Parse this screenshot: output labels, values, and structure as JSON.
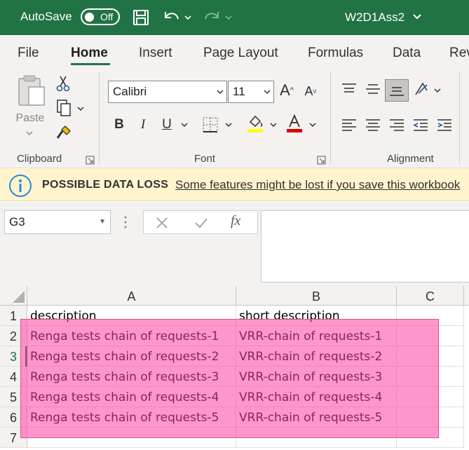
{
  "titlebar": {
    "autosave_label": "AutoSave",
    "autosave_state": "Off",
    "doc_title": "W2D1Ass2",
    "bg_color": "#217346"
  },
  "tabs": [
    {
      "label": "File",
      "active": false
    },
    {
      "label": "Home",
      "active": true
    },
    {
      "label": "Insert",
      "active": false
    },
    {
      "label": "Page Layout",
      "active": false
    },
    {
      "label": "Formulas",
      "active": false
    },
    {
      "label": "Data",
      "active": false
    },
    {
      "label": "Rev",
      "active": false
    }
  ],
  "ribbon": {
    "clipboard": {
      "label": "Clipboard",
      "paste_label": "Paste"
    },
    "font": {
      "label": "Font",
      "font_name": "Calibri",
      "font_size": "11",
      "bold": "B",
      "italic": "I",
      "underline": "U",
      "highlight_color": "#ffff00",
      "font_color": "#e00000"
    },
    "alignment": {
      "label": "Alignment"
    }
  },
  "infobar": {
    "title": "POSSIBLE DATA LOSS",
    "message": "Some features might be lost if you save this workbook"
  },
  "formula_bar": {
    "name_box": "G3",
    "fx_label": "fx",
    "value": ""
  },
  "grid": {
    "columns": [
      "A",
      "B",
      "C"
    ],
    "rows": [
      {
        "num": "1",
        "a": "description",
        "b": "short description",
        "c": ""
      },
      {
        "num": "2",
        "a": "Renga tests chain of requests-1",
        "b": "VRR-chain of requests-1",
        "c": ""
      },
      {
        "num": "3",
        "a": "Renga tests chain of requests-2",
        "b": "VRR-chain of requests-2",
        "c": ""
      },
      {
        "num": "4",
        "a": "Renga tests chain of requests-3",
        "b": "VRR-chain of requests-3",
        "c": ""
      },
      {
        "num": "5",
        "a": "Renga tests chain of requests-4",
        "b": "VRR-chain of requests-4",
        "c": ""
      },
      {
        "num": "6",
        "a": "Renga tests chain of requests-5",
        "b": "VRR-chain of requests-5",
        "c": ""
      },
      {
        "num": "7",
        "a": "",
        "b": "",
        "c": ""
      }
    ],
    "active_row": "3",
    "selection_color": "#ff40a0"
  },
  "icons": [
    "save-icon",
    "undo-icon",
    "redo-icon",
    "cut-icon",
    "copy-icon",
    "format-painter-icon",
    "borders-icon",
    "fill-color-icon",
    "font-color-icon",
    "info-icon"
  ]
}
